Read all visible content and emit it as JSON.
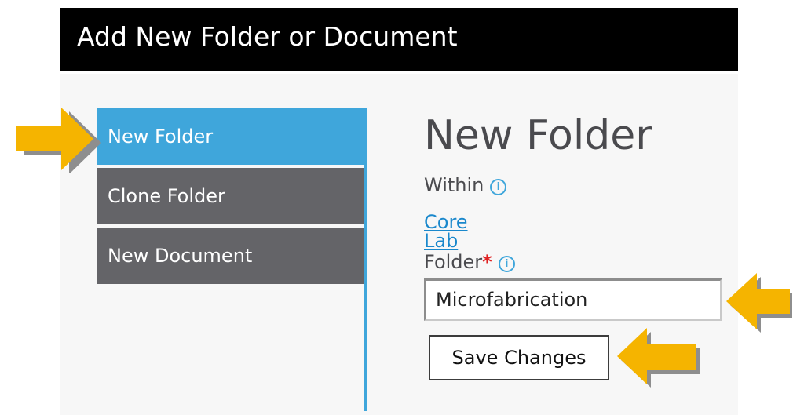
{
  "dialog": {
    "title": "Add New Folder or Document",
    "menu": [
      {
        "label": "New Folder",
        "active": true
      },
      {
        "label": "Clone Folder",
        "active": false
      },
      {
        "label": "New Document",
        "active": false
      }
    ],
    "form": {
      "heading": "New Folder",
      "within_label": "Within",
      "within_link": "Core Lab",
      "folder_label": "Folder",
      "required_marker": "*",
      "folder_value": "Microfabrication",
      "save_label": "Save Changes"
    }
  },
  "annotations": {
    "arrow_color": "#f5b400",
    "arrow_shadow_color": "#8e8e8e",
    "arrow_targets": [
      "menu-item-new-folder",
      "folder-name-input",
      "save-changes-button"
    ]
  },
  "colors": {
    "title_bar": "#000000",
    "active_item": "#3fa6db",
    "inactive_item": "#646468",
    "link": "#1a88cc",
    "required": "#e02020"
  },
  "icons": {
    "info": "info-circle-icon",
    "info_glyph": "i"
  }
}
